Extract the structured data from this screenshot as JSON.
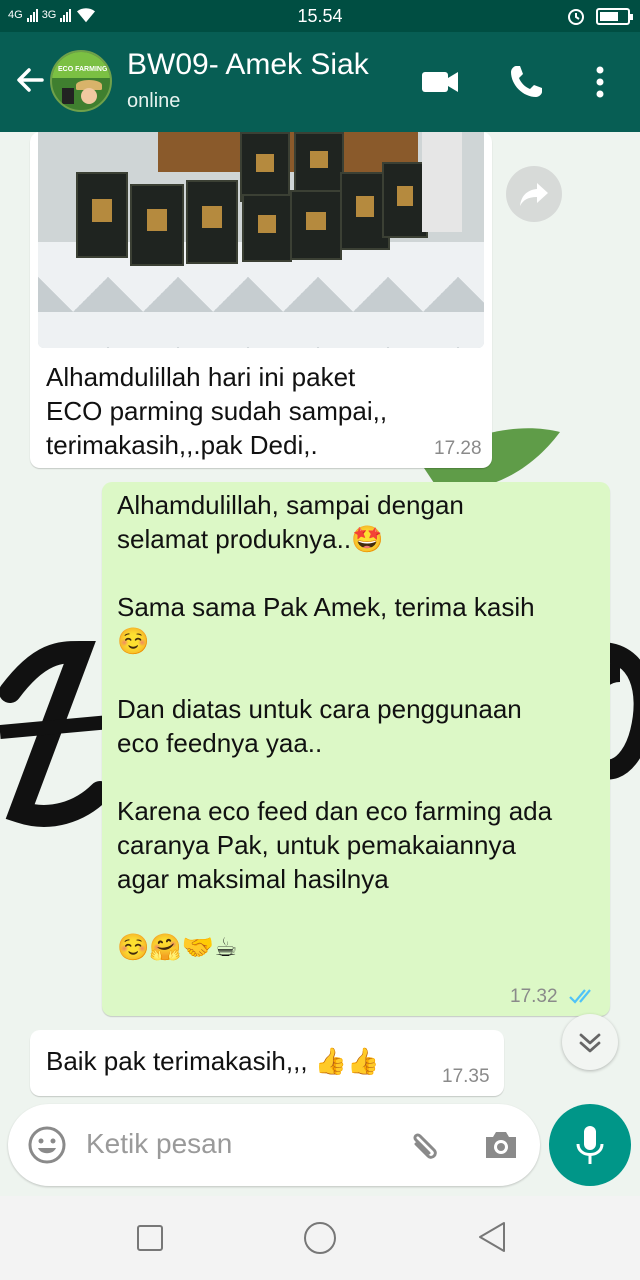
{
  "status_bar": {
    "time": "15.54",
    "network_1": "4G",
    "network_2": "3G",
    "icons": [
      "signal-icon",
      "wifi-icon",
      "alarm-icon",
      "battery-icon"
    ]
  },
  "header": {
    "contact_name": "BW09- Amek Siak",
    "contact_status": "online",
    "avatar_text": "ECO FARMING",
    "icons": [
      "back-arrow-icon",
      "video-call-icon",
      "phone-call-icon",
      "more-vert-icon"
    ],
    "colors": {
      "toolbar": "#075e54",
      "status_bar": "#004e42"
    }
  },
  "messages": [
    {
      "direction": "incoming",
      "has_image": true,
      "text": "Alhamdulillah hari ini paket\nECO parming sudah sampai,,\nterimakasih,,.pak Dedi,.",
      "time": "17.28"
    },
    {
      "direction": "outgoing",
      "text": "Alhamdulillah, sampai dengan\nselamat produknya..🤩\n\nSama sama Pak Amek, terima kasih\n☺️\n\nDan diatas untuk cara penggunaan\neco feednya yaa..\n\nKarena eco feed dan eco farming ada\ncaranya Pak, untuk pemakaiannya\nagar maksimal hasilnya\n\n☺️🤗🤝☕",
      "time": "17.32",
      "read_status": "double-check-blue"
    },
    {
      "direction": "incoming",
      "text": "Baik pak terimakasih,,, 👍👍",
      "time": "17.35"
    }
  ],
  "wallpaper_text": "Zo",
  "input": {
    "placeholder": "Ketik pesan",
    "icons": [
      "emoji-icon",
      "attach-icon",
      "camera-icon",
      "mic-icon"
    ]
  },
  "colors": {
    "incoming_bubble": "#ffffff",
    "outgoing_bubble": "#dcf8c6",
    "read_ticks": "#4fc3f7",
    "mic_button": "#009688"
  },
  "nav": [
    "recent-apps-icon",
    "home-icon",
    "back-nav-icon"
  ]
}
